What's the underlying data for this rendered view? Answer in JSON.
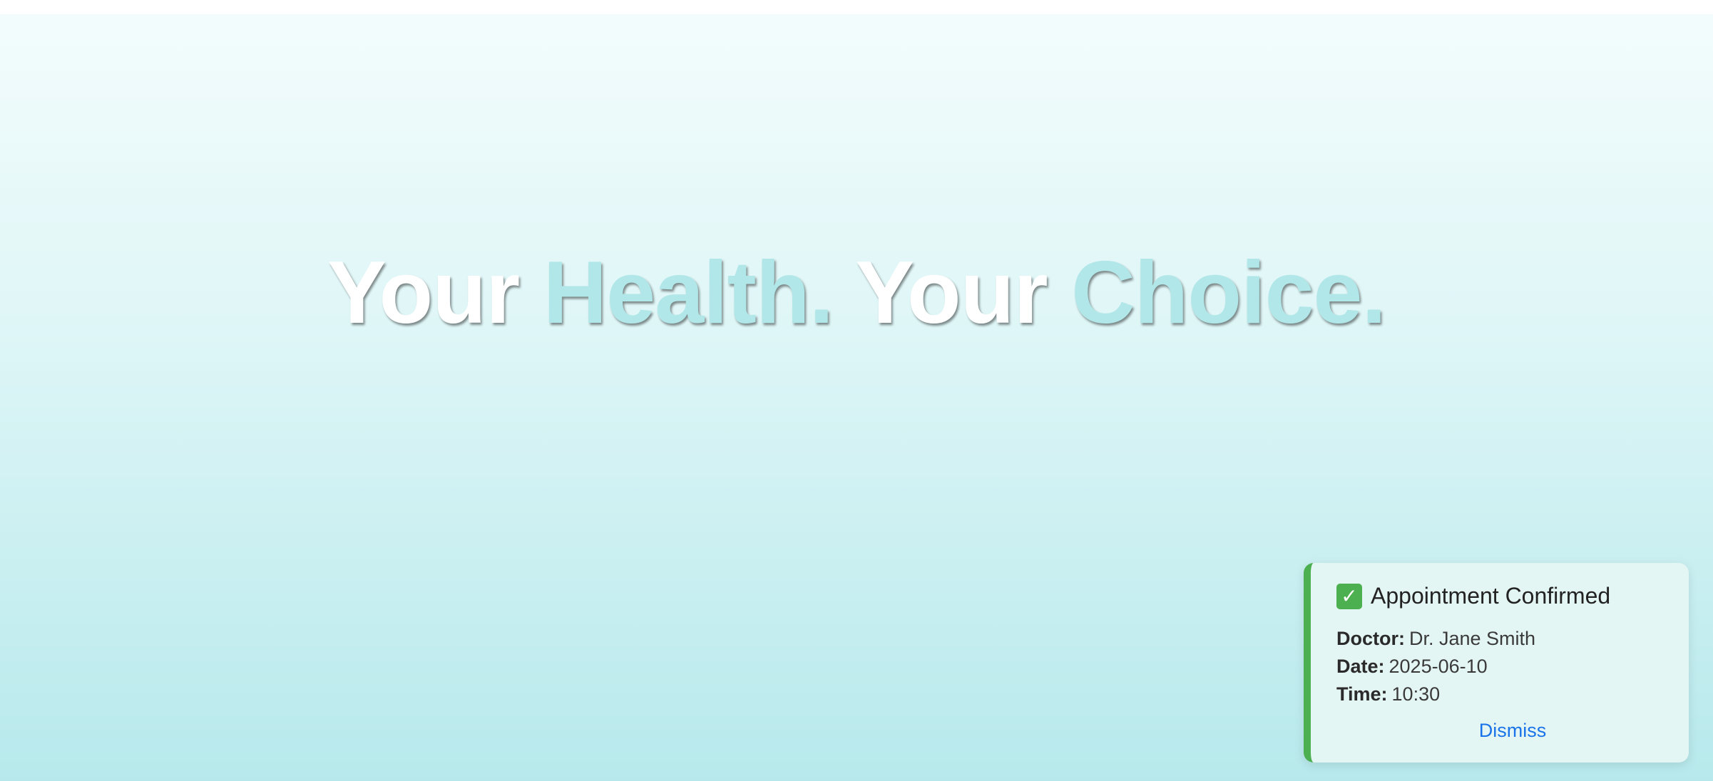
{
  "hero": {
    "headline_part1": "Your ",
    "headline_part2": "Health.",
    "headline_part3": " Your ",
    "headline_part4": "Choice."
  },
  "toast": {
    "title": "Appointment Confirmed",
    "icon": "check-mark-icon",
    "doctor_label": "Doctor:",
    "doctor_value": "Dr. Jane Smith",
    "date_label": "Date:",
    "date_value": "2025-06-10",
    "time_label": "Time:",
    "time_value": "10:30",
    "dismiss_label": "Dismiss",
    "accent_color": "#4caf50",
    "link_color": "#1a73e8"
  }
}
